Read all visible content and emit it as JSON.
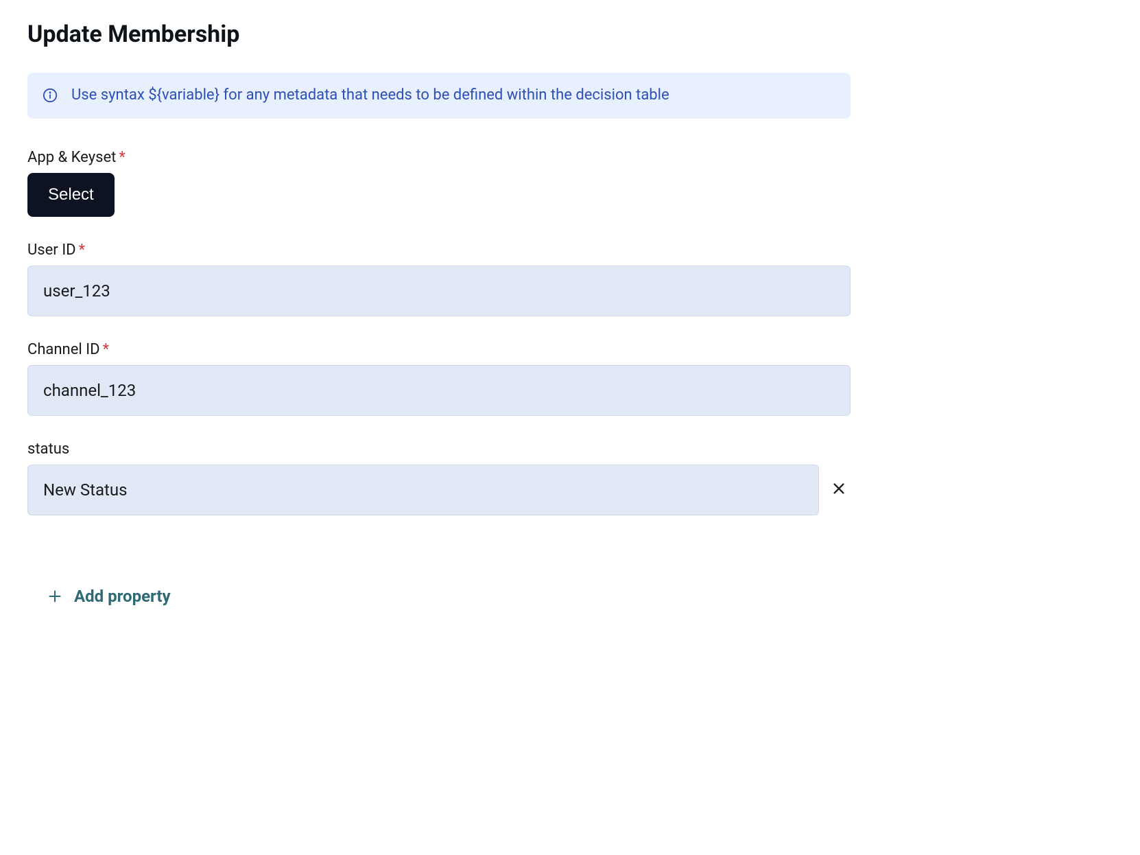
{
  "title": "Update Membership",
  "info_banner": {
    "text": "Use syntax ${variable} for any metadata that needs to be defined within the decision table"
  },
  "fields": {
    "app_keyset": {
      "label": "App & Keyset",
      "required": "*",
      "button_label": "Select"
    },
    "user_id": {
      "label": "User ID",
      "required": "*",
      "value": "user_123"
    },
    "channel_id": {
      "label": "Channel ID",
      "required": "*",
      "value": "channel_123"
    },
    "status": {
      "label": "status",
      "value": "New Status"
    }
  },
  "add_property_label": "Add property"
}
